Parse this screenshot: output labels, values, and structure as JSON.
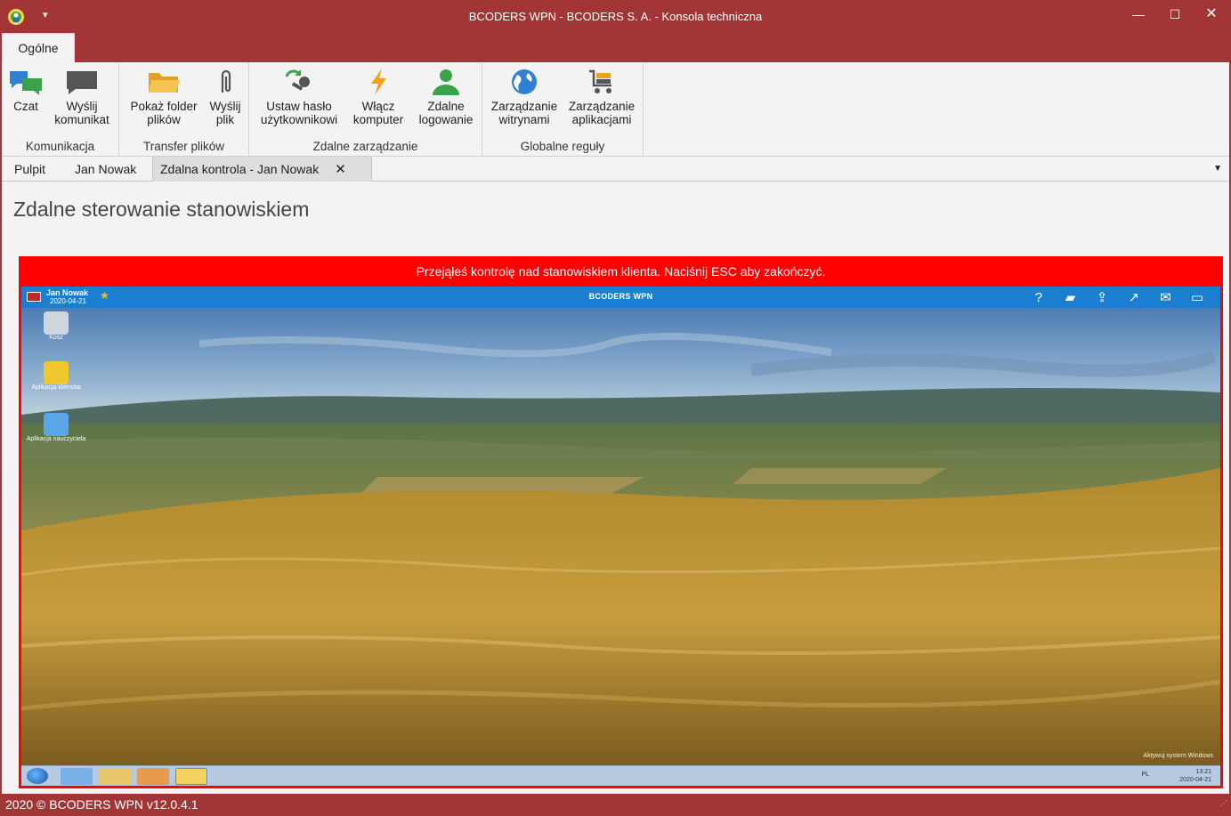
{
  "window": {
    "title": "BCODERS WPN - BCODERS S. A. - Konsola techniczna",
    "minimize": "—",
    "maximize": "☐",
    "close": "✕",
    "quick_access": "▾"
  },
  "ribbon": {
    "tab": "Ogólne",
    "groups": [
      {
        "label": "Komunikacja",
        "buttons": [
          "Czat",
          "Wyślij\nkomunikat"
        ]
      },
      {
        "label": "Transfer plików",
        "buttons": [
          "Pokaż folder\nplików",
          "Wyślij\nplik"
        ]
      },
      {
        "label": "Zdalne zarządzanie",
        "buttons": [
          "Ustaw hasło\nużytkownikowi",
          "Włącz\nkomputer",
          "Zdalne\nlogowanie"
        ]
      },
      {
        "label": "Globalne reguły",
        "buttons": [
          "Zarządzanie\nwitrynami",
          "Zarządzanie\naplikacjami"
        ]
      }
    ]
  },
  "doc_tabs": {
    "items": [
      "Pulpit",
      "Jan Nowak",
      "Zdalna kontrola - Jan Nowak"
    ],
    "close": "✕",
    "menu": "▼"
  },
  "content": {
    "title": "Zdalne sterowanie stanowiskiem",
    "banner": "Przejąłeś kontrolę nad stanowiskiem klienta. Naciśnij ESC aby zakończyć."
  },
  "remote": {
    "user_name": "Jan Nowak",
    "user_date": "2020-04-21",
    "app_title": "BCODERS WPN",
    "toolbar_icons": [
      "help-icon",
      "folder-icon",
      "upload-icon",
      "chart-icon",
      "mail-icon",
      "chat-icon"
    ],
    "toolbar_glyphs": [
      "?",
      "▰",
      "⇪",
      "↗",
      "✉",
      "▭"
    ],
    "desktop_icons": [
      "Kosz",
      "Aplikacja kliencka",
      "Aplikacja nauczyciela"
    ],
    "tray_lang": "PL",
    "clock_time": "13:21",
    "clock_date": "2020-04-21",
    "activate_text": "Aktywuj system Windows"
  },
  "status": {
    "text": "2020 ©  BCODERS WPN v12.0.4.1",
    "grip": "⋰"
  },
  "colors": {
    "accent": "#a23637",
    "banner": "#ff0000",
    "remote_bar": "#1a7fd0"
  }
}
